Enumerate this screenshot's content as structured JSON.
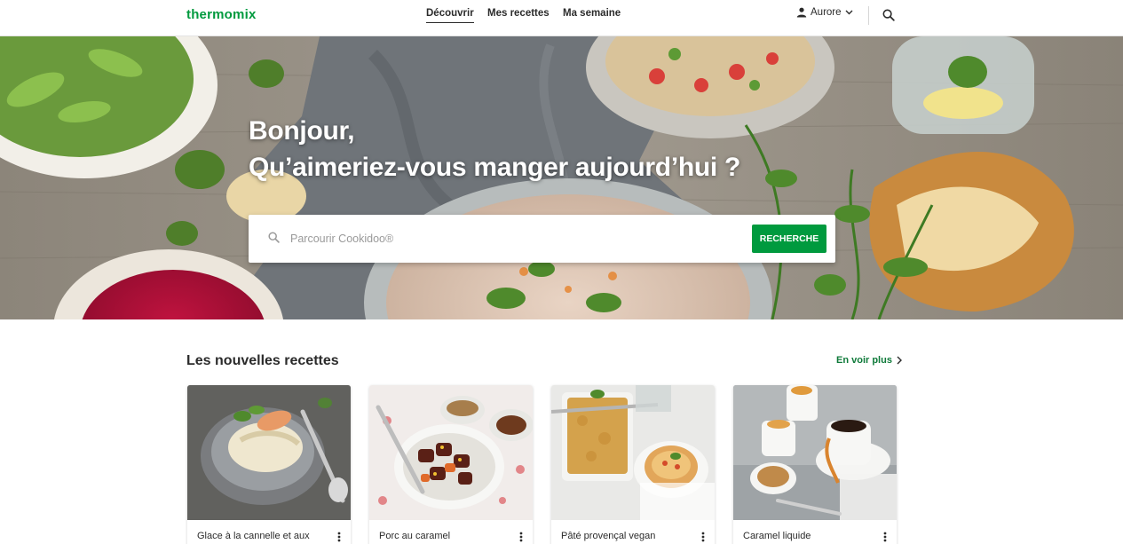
{
  "header": {
    "logo": "thermomix",
    "nav": [
      {
        "label": "Découvrir",
        "active": true
      },
      {
        "label": "Mes recettes",
        "active": false
      },
      {
        "label": "Ma semaine",
        "active": false
      }
    ],
    "user": {
      "name": "Aurore",
      "icon": "person-icon",
      "chevron": "chevron-down-icon"
    },
    "search_icon": "search-icon"
  },
  "hero": {
    "line1": "Bonjour,",
    "line2": "Qu’aimeriez-vous manger aujourd’hui ?",
    "search": {
      "placeholder": "Parcourir Cookidoo®",
      "value": "",
      "button": "RECHERCHE"
    }
  },
  "section": {
    "title": "Les nouvelles recettes",
    "see_more": "En voir plus",
    "cards": [
      {
        "title": "Glace à la cannelle et aux"
      },
      {
        "title": "Porc au caramel"
      },
      {
        "title": "Pâté provençal vegan"
      },
      {
        "title": "Caramel liquide"
      }
    ]
  },
  "colors": {
    "brand": "#009a3e",
    "link": "#0f7a3a",
    "text": "#2b2b2b"
  }
}
